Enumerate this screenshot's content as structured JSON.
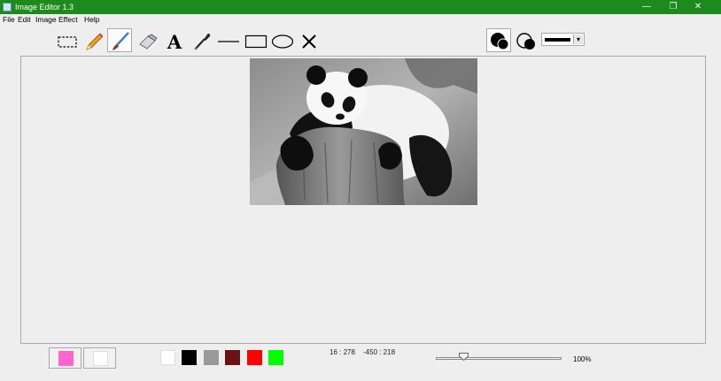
{
  "window": {
    "title": "Image Editor 1.3",
    "minimize": "—",
    "restore": "❐",
    "close": "✕"
  },
  "menus": [
    "File",
    "Edit",
    "Image",
    "Effect",
    "Help"
  ],
  "tools": [
    {
      "name": "select-tool",
      "icon": "dashed-rectangle-icon",
      "selected": false
    },
    {
      "name": "pencil-tool",
      "icon": "pencil-icon",
      "selected": false
    },
    {
      "name": "brush-tool",
      "icon": "paintbrush-icon",
      "selected": true
    },
    {
      "name": "eraser-tool",
      "icon": "eraser-icon",
      "selected": false
    },
    {
      "name": "text-tool",
      "icon": "text-icon",
      "label": "A",
      "selected": false
    },
    {
      "name": "eyedropper-tool",
      "icon": "eyedropper-icon",
      "selected": false
    },
    {
      "name": "line-tool",
      "icon": "line-icon",
      "selected": false
    },
    {
      "name": "rectangle-tool",
      "icon": "rectangle-icon",
      "selected": false
    },
    {
      "name": "ellipse-tool",
      "icon": "ellipse-icon",
      "selected": false
    },
    {
      "name": "clear-tool",
      "icon": "x-icon",
      "label": "×",
      "selected": false
    }
  ],
  "fill_modes": [
    {
      "name": "filled-shape-mode",
      "icon": "filled-circles-icon",
      "selected": true
    },
    {
      "name": "outline-shape-mode",
      "icon": "outline-circles-icon",
      "selected": false
    }
  ],
  "stroke_selector": {
    "icon": "thick-line-icon",
    "arrow": "▾"
  },
  "image": {
    "subject": "panda-photo"
  },
  "colors": {
    "primary": "#ff66cc",
    "secondary": "#ffffff",
    "palette": [
      "#ffffff",
      "#000000",
      "#999999",
      "#6b1313",
      "#ff0000",
      "#00ff00"
    ],
    "title_bar": "#1c8a1c"
  },
  "status": {
    "cursor_position": "16 : 278",
    "selection_size": "-450 : 218",
    "zoom_label": "100%",
    "zoom_fraction": 0.22
  }
}
